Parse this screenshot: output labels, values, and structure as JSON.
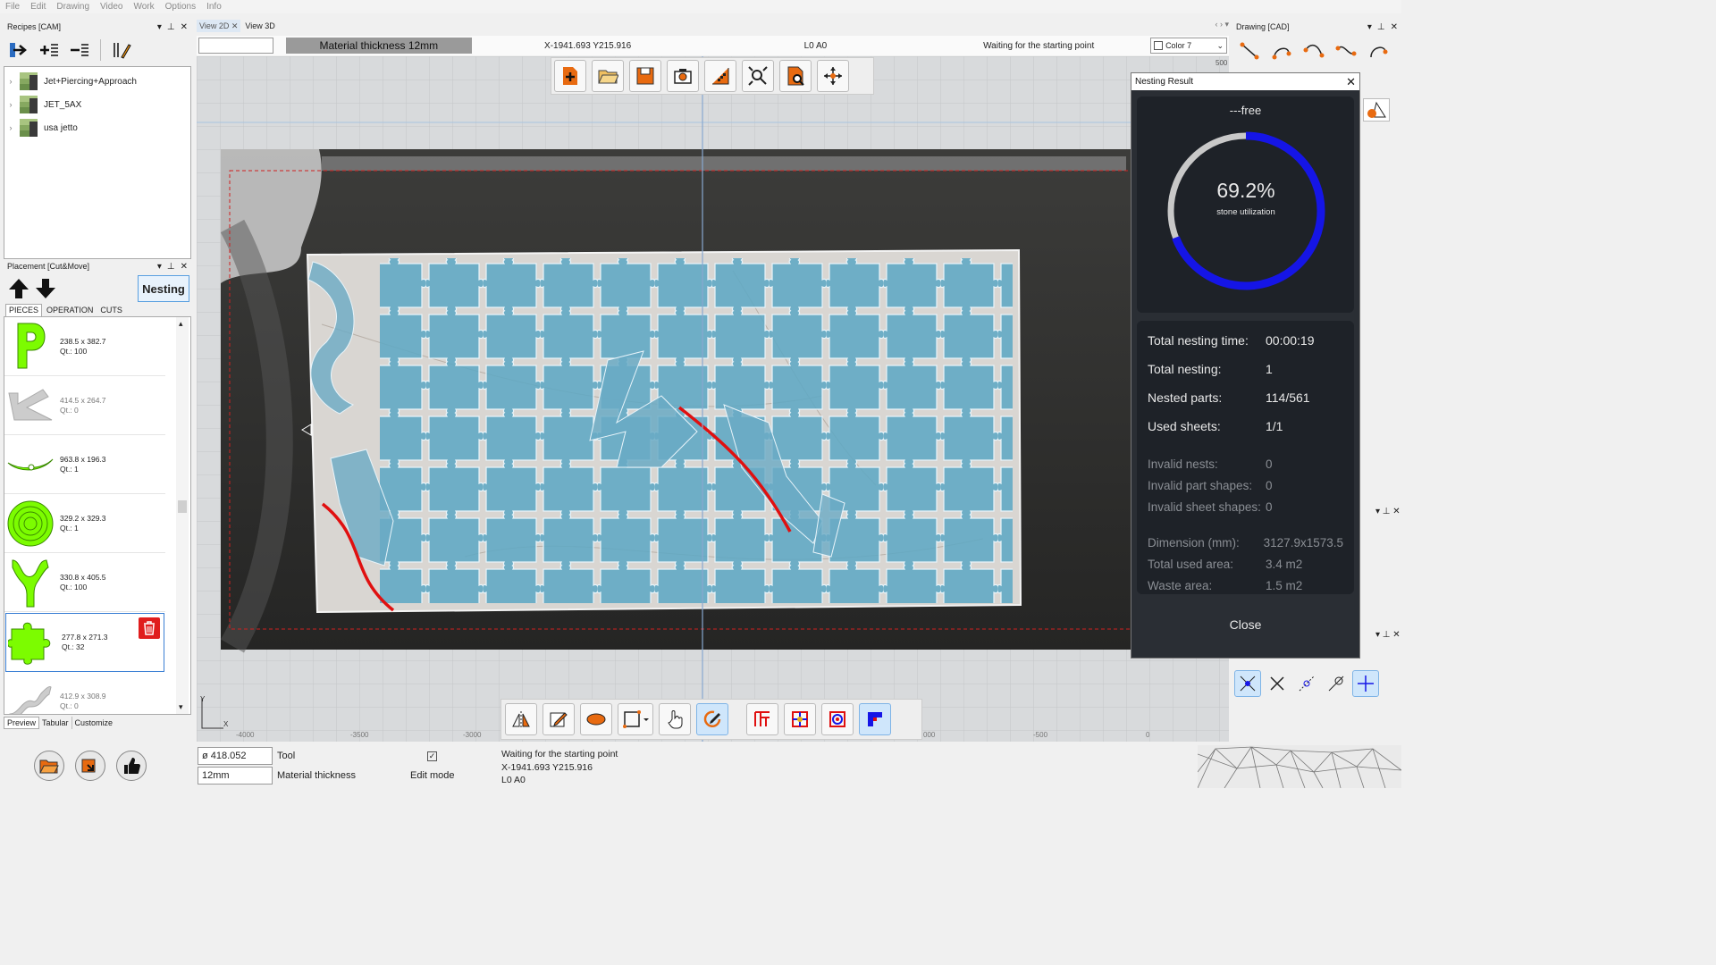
{
  "menu": [
    "File",
    "Edit",
    "Drawing",
    "Video",
    "Work",
    "Options",
    "Info"
  ],
  "recipes": {
    "title": "Recipes [CAM]",
    "items": [
      "Jet+Piercing+Approach",
      "JET_5AX",
      "usa jetto"
    ]
  },
  "placement": {
    "title": "Placement [Cut&Move]",
    "nesting_label": "Nesting",
    "tabs": [
      "PIECES",
      "OPERATION",
      "CUTS"
    ],
    "pieces": [
      {
        "dim": "238.5 x 382.7",
        "qty": "Qt.: 100"
      },
      {
        "dim": "414.5 x 264.7",
        "qty": "Qt.: 0"
      },
      {
        "dim": "963.8 x 196.3",
        "qty": "Qt.: 1"
      },
      {
        "dim": "329.2 x 329.3",
        "qty": "Qt.: 1"
      },
      {
        "dim": "330.8 x 405.5",
        "qty": "Qt.: 100"
      },
      {
        "dim": "277.8 x 271.3",
        "qty": "Qt.: 32"
      },
      {
        "dim": "412.9 x 308.9",
        "qty": "Qt.: 0"
      }
    ],
    "bottom_tabs": [
      "Preview",
      "Tabular",
      "Customize"
    ]
  },
  "views": {
    "tab2d": "View 2D",
    "tab3d": "View 3D"
  },
  "status": {
    "thickness_banner": "Material thickness 12mm",
    "coords": "X-1941.693 Y215.916",
    "layer": "L0 A0",
    "message": "Waiting for the starting point",
    "color": "Color 7"
  },
  "ruler": {
    "top_right": "500",
    "bottom": [
      "-4000",
      "-3500",
      "-3000",
      "000",
      "-500",
      "0"
    ]
  },
  "axes": {
    "x": "X",
    "y": "Y"
  },
  "drawing": {
    "title": "Drawing [CAD]"
  },
  "nesting_result": {
    "title": "Nesting Result",
    "mode": "---free",
    "percent": "69.2%",
    "percent_value": 69.2,
    "percent_label": "stone utilization",
    "stats": [
      {
        "k": "Total nesting time:",
        "v": "00:00:19"
      },
      {
        "k": "Total nesting:",
        "v": "1"
      },
      {
        "k": "Nested parts:",
        "v": "114/561"
      },
      {
        "k": "Used sheets:",
        "v": "1/1"
      }
    ],
    "invalid": [
      {
        "k": "Invalid nests:",
        "v": "0"
      },
      {
        "k": "Invalid part shapes:",
        "v": "0"
      },
      {
        "k": "Invalid sheet shapes:",
        "v": "0"
      }
    ],
    "area": [
      {
        "k": "Dimension (mm):",
        "v": "3127.9x1573.5"
      },
      {
        "k": "Total used area:",
        "v": "3.4 m2"
      },
      {
        "k": "Waste area:",
        "v": "1.5 m2"
      }
    ],
    "close": "Close"
  },
  "bottom": {
    "tool_value": "ø 418.052",
    "tool_label": "Tool",
    "thickness_value": "12mm",
    "thickness_label": "Material thickness",
    "edit_mode": "Edit mode",
    "status1": "Waiting for the starting point",
    "status2": "X-1941.693 Y215.916",
    "status3": "L0 A0"
  },
  "colors": {
    "accent": "#1515e6",
    "piece_green": "#7cfc00",
    "puzzle": "#5fa8c4",
    "cut_red": "#e01010",
    "dialog_bg": "#23272e"
  }
}
